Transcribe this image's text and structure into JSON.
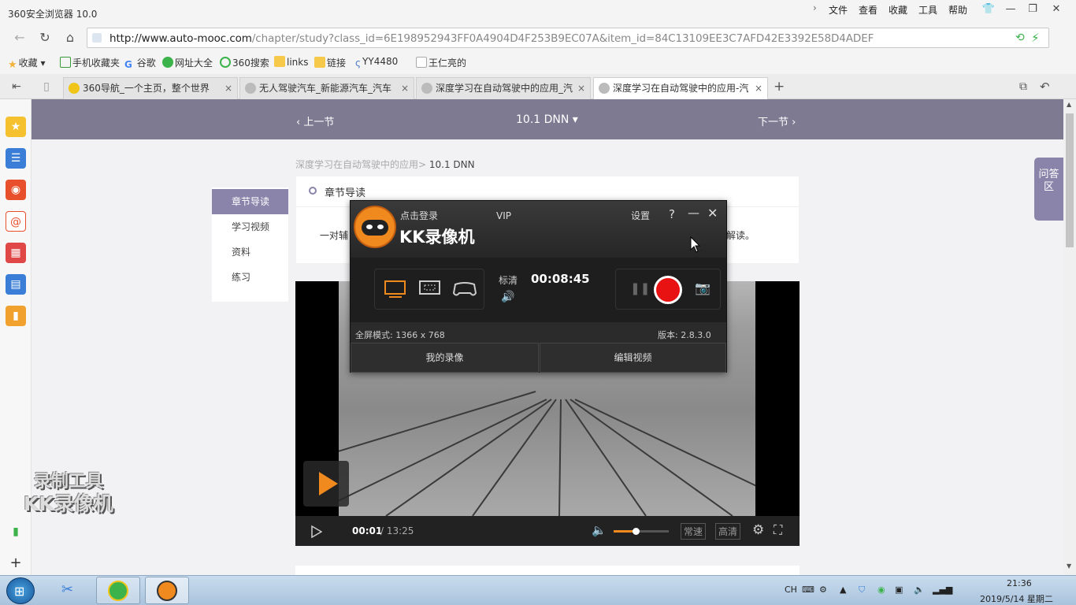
{
  "browser": {
    "title": "360安全浏览器 10.0",
    "menu": [
      "文件",
      "查看",
      "收藏",
      "工具",
      "帮助"
    ],
    "url_host": "http://www.auto-mooc.com",
    "url_rest": "/chapter/study?class_id=6E198952943FF0A4904D4F253B9EC07A&item_id=84C13109EE3C7AFD42E3392E58D4ADEF",
    "favorites": [
      "收藏",
      "手机收藏夹",
      "谷歌",
      "网址大全",
      "360搜索",
      "links",
      "链接",
      "YY4480",
      "王仁亮的"
    ],
    "tabs": [
      "360导航_一个主页，整个世界",
      "无人驾驶汽车_新能源汽车_汽车",
      "深度学习在自动驾驶中的应用_汽",
      "深度学习在自动驾驶中的应用-汽"
    ]
  },
  "page": {
    "prev": "上一节",
    "current": "10.1 DNN",
    "next": "下一节",
    "breadcrumb_parent": "深度学习在自动驾驶中的应用>",
    "breadcrumb_current": "10.1 DNN",
    "nav": [
      "章节导读",
      "学习视频",
      "资料",
      "练习"
    ],
    "guide_title": "章节导读",
    "guide_text_left": "一对辅",
    "guide_text_right": "解读。",
    "qa": "问答区"
  },
  "video": {
    "time_current": "00:01",
    "time_total": "/ 13:25",
    "speed": "常速",
    "quality": "高清",
    "volume_level": 0.4
  },
  "kk": {
    "login": "点击登录",
    "vip": "VIP",
    "settings": "设置",
    "help": "?",
    "app_name": "KK录像机",
    "quality": "标清",
    "timer": "00:08:45",
    "mode": "全屏模式: 1366 x 768",
    "version": "版本: 2.8.3.0",
    "my_videos": "我的录像",
    "edit_video": "编辑视频"
  },
  "watermark": {
    "line1": "录制工具",
    "line2": "KK录像机"
  },
  "taskbar": {
    "ime": "CH",
    "time": "21:36",
    "date": "2019/5/14 星期二"
  }
}
